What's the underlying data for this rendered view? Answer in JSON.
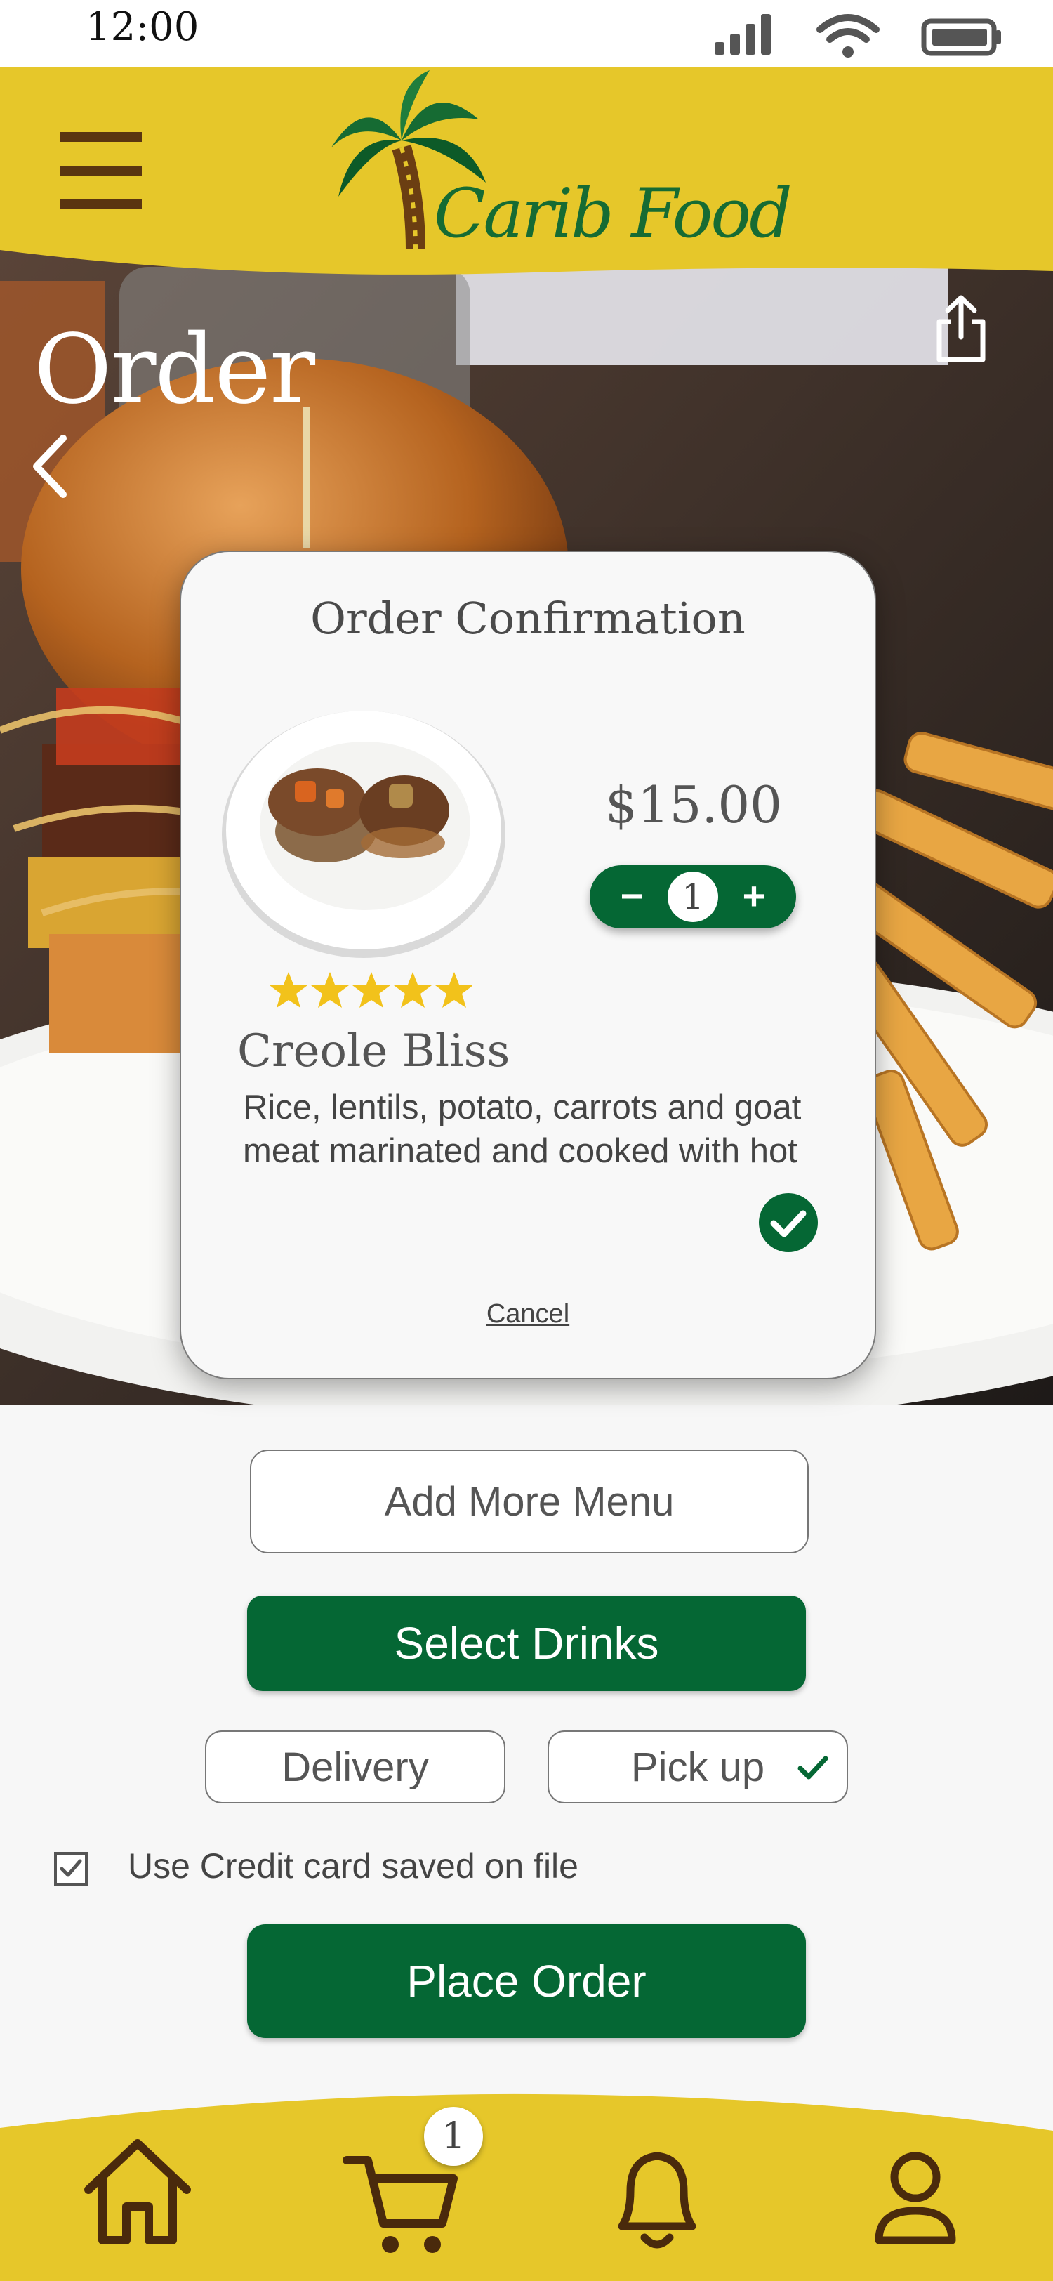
{
  "status_bar": {
    "time": "12:00"
  },
  "header": {
    "brand": "Carib Food"
  },
  "page": {
    "title": "Order"
  },
  "modal": {
    "title": "Order  Confirmation",
    "price": "$15.00",
    "quantity": "1",
    "minus_label": "−",
    "plus_label": "+",
    "rating": 5,
    "dish_name": "Creole Bliss",
    "description_line1": "Rice, lentils, potato, carrots  and goat",
    "description_line2": "meat marinated and cooked with hot",
    "cancel_label": "Cancel"
  },
  "actions": {
    "add_more": "Add  More Menu",
    "select_drinks": "Select Drinks",
    "delivery": "Delivery",
    "pickup": "Pick up",
    "credit_card": "Use Credit card saved on file",
    "place_order": "Place Order"
  },
  "nav": {
    "cart_count": "1"
  },
  "colors": {
    "brand_yellow": "#e6c72a",
    "brand_green": "#056734",
    "brand_brown": "#5a3510"
  }
}
